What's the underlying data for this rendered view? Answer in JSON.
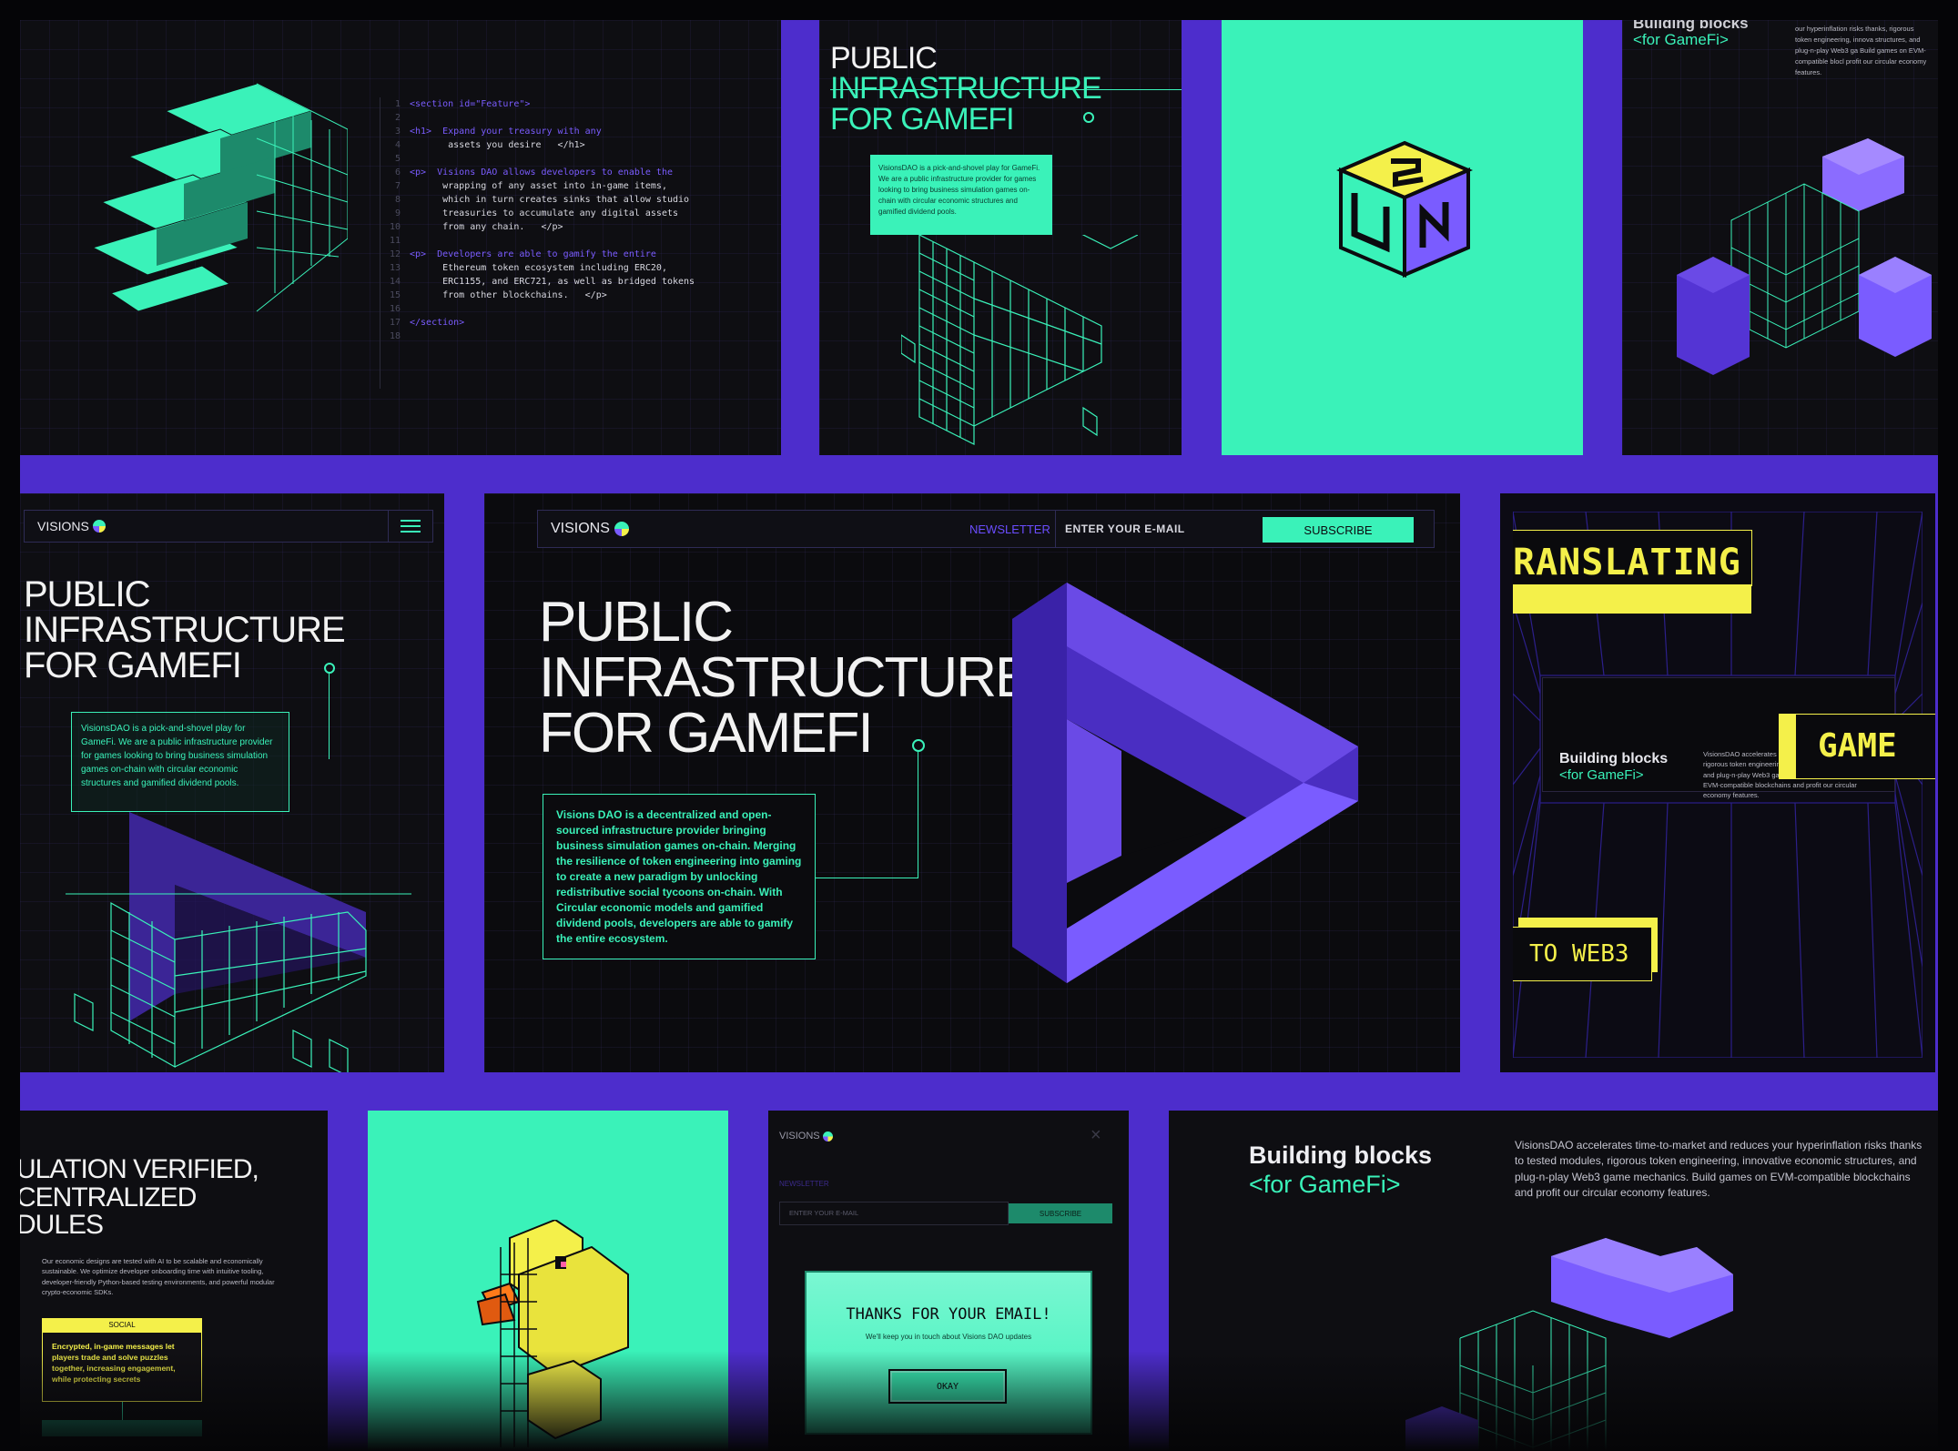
{
  "colors": {
    "purple": "#4d2dcc",
    "mint": "#3af2b9",
    "dark": "#0e0e12",
    "yellow": "#f4f04a",
    "violet": "#7a5cff"
  },
  "code_card": {
    "line_numbers": [
      "1",
      "2",
      "3",
      "4",
      "5",
      "6",
      "7",
      "8",
      "9",
      "10",
      "11",
      "12",
      "13",
      "14",
      "15",
      "16",
      "17",
      "18"
    ],
    "lines": [
      "<section id=\"Feature\">",
      "",
      "<h1>  Expand your treasury with any",
      "       assets you desire   </h1>",
      "",
      "<p>  Visions DAO allows developers to enable the",
      "      wrapping of any asset into in-game items,",
      "      which in turn creates sinks that allow studio",
      "      treasuries to accumulate any digital assets",
      "      from any chain.   </p>",
      "",
      "<p>  Developers are able to gamify the entire",
      "      Ethereum token ecosystem including ERC20,",
      "      ERC1155, and ERC721, as well as bridged tokens",
      "      from other blockchains.   </p>",
      "",
      "</section>"
    ]
  },
  "top_mid": {
    "title_line1": "PUBLIC",
    "title_line2": "INFRASTRUCTURE",
    "title_line3": "FOR GAMEFI",
    "body": "VisionsDAO is a pick-and-shovel play for GameFi. We are a public infrastructure provider for games looking to bring business simulation games on-chain with circular economic structures and gamified dividend pools."
  },
  "top_right": {
    "heading": "Building blocks",
    "subheading": "<for GameFi>",
    "body": "our hyperinflation risks thanks, rigorous token engineering, innova structures, and plug-n-play Web3 ga Build games on EVM-compatible blocl profit our circular economy features."
  },
  "mobile_card": {
    "logo": "VISIONS",
    "title_line1": "PUBLIC",
    "title_line2": "INFRASTRUCTURE",
    "title_line3": "FOR GAMEFI",
    "body": "VisionsDAO is a pick-and-shovel play for GameFi. We are a public infrastructure provider for games looking to bring business simulation games on-chain with circular economic structures and gamified dividend pools."
  },
  "hero": {
    "logo": "VISIONS",
    "nav_newsletter": "NEWSLETTER",
    "email_placeholder": "ENTER YOUR E-MAIL",
    "subscribe": "SUBSCRIBE",
    "title_line1": "PUBLIC",
    "title_line2": "INFRASTRUCTURE",
    "title_line3": "FOR GAMEFI",
    "body": "Visions DAO is a decentralized and open-sourced infrastructure provider bringing business simulation games on-chain. Merging the resilience of token engineering into gaming to create a new paradigm by unlocking redistributive social tycoons on-chain. With Circular economic models and gamified dividend pools, developers are able to gamify the entire ecosystem."
  },
  "translate_card": {
    "tag1": "RANSLATING",
    "tag2": "GAME",
    "tag3": "TO WEB3",
    "heading": "Building blocks",
    "subheading": "<for GameFi>",
    "body": "VisionsDAO accelerates time your hyperinflation risks tha rigorous token engineering, innovative economic structures, and plug-n-play Web3 game mechanics. Build games on EVM-compatible blockchains and profit our circular economy features."
  },
  "sim_card": {
    "title_line1": "ULATION VERIFIED,",
    "title_line2": "CENTRALIZED",
    "title_line3": "DULES",
    "body": "Our economic designs are tested with AI to be scalable and economically sustainable. We optimize developer onboarding time with intuitive tooling, developer-friendly Python-based testing environments, and powerful modular crypto-economic SDKs.",
    "tag": "SOCIAL",
    "tag_body": "Encrypted, in-game messages let players trade and solve puzzles together, increasing engagement, while protecting secrets"
  },
  "modal_card": {
    "logo": "VISIONS",
    "newsletter": "NEWSLETTER",
    "email_placeholder": "ENTER YOUR E-MAIL",
    "subscribe": "SUBSCRIBE",
    "thanks": "THANKS FOR YOUR EMAIL!",
    "thanks_sub": "We'll keep you in touch about Visions DAO updates",
    "okay": "OKAY"
  },
  "bottom_right": {
    "heading": "Building blocks",
    "subheading": "<for GameFi>",
    "body": "VisionsDAO accelerates time-to-market and reduces your hyperinflation risks thanks to tested modules, rigorous token engineering, innovative economic structures, and plug-n-play Web3 game mechanics. Build games on EVM-compatible blockchains and profit our circular economy features."
  }
}
